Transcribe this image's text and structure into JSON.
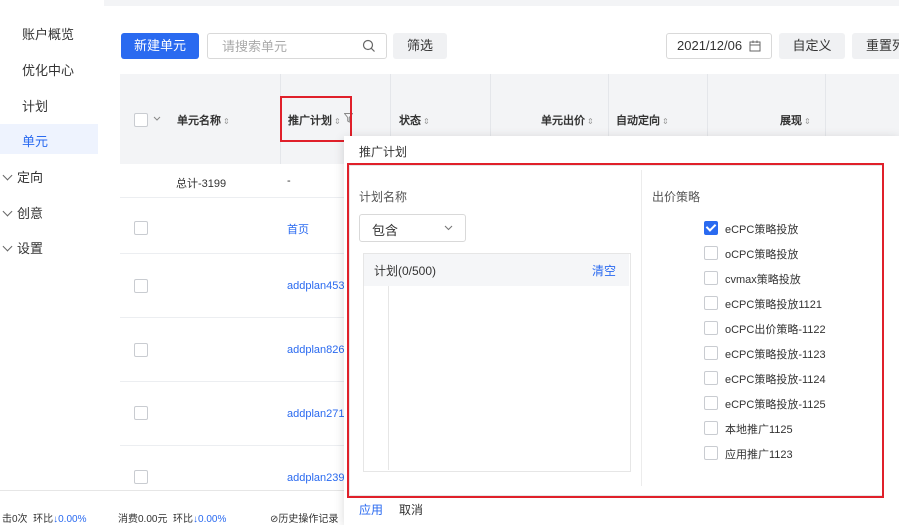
{
  "sidebar": {
    "items": [
      "账户概览",
      "优化中心",
      "计划",
      "单元"
    ],
    "groups": [
      "定向",
      "创意",
      "设置"
    ]
  },
  "toolbar": {
    "new_unit": "新建单元",
    "search_placeholder": "请搜索单元",
    "filter": "筛选",
    "date": "2021/12/06",
    "custom": "自定义",
    "reset": "重置列"
  },
  "table": {
    "headers": [
      "单元名称",
      "推广计划",
      "状态",
      "单元出价",
      "自动定向",
      "展现"
    ],
    "summary_label": "总计-3199",
    "summary_plan": "-",
    "rows": [
      "首页",
      "addplan453",
      "addplan826",
      "addplan271",
      "addplan239"
    ]
  },
  "popup": {
    "title": "推广计划",
    "plan_name_label": "计划名称",
    "match_mode": "包含",
    "list_title": "计划(0/500)",
    "clear": "清空",
    "strategy_label": "出价策略",
    "strategies": [
      {
        "label": "eCPC策略投放",
        "checked": true
      },
      {
        "label": "oCPC策略投放",
        "checked": false
      },
      {
        "label": "cvmax策略投放",
        "checked": false
      },
      {
        "label": "eCPC策略投放1121",
        "checked": false
      },
      {
        "label": "oCPC出价策略-1122",
        "checked": false
      },
      {
        "label": "eCPC策略投放-1123",
        "checked": false
      },
      {
        "label": "eCPC策略投放-1124",
        "checked": false
      },
      {
        "label": "eCPC策略投放-1125",
        "checked": false
      },
      {
        "label": "本地推广1125",
        "checked": false
      },
      {
        "label": "应用推广1123",
        "checked": false
      }
    ],
    "apply": "应用",
    "cancel": "取消"
  },
  "footer": {
    "clicks": "击0次",
    "clicks_ratio_label": "环比",
    "clicks_ratio": "↓0.00%",
    "cost": "消费0.00元",
    "cost_ratio_label": "环比",
    "cost_ratio": "↓0.00%",
    "history": "历史操作记录"
  },
  "colors": {
    "accent": "#2a6af0",
    "highlight": "#e0202a"
  }
}
